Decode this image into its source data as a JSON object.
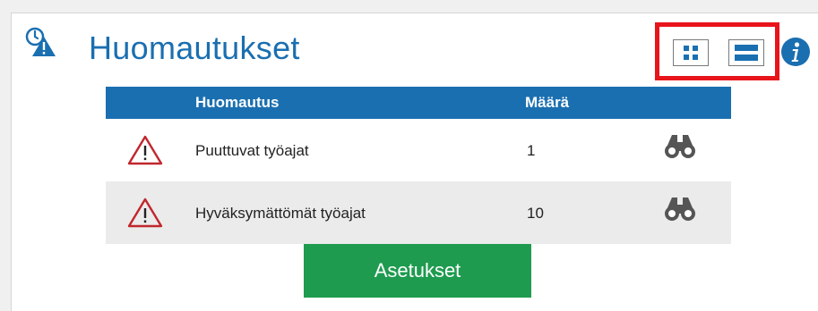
{
  "widget": {
    "title": "Huomautukset",
    "header_icon": "clock-warning-icon",
    "info_icon": "info-icon",
    "view_toggle": {
      "grid_icon": "grid-view-icon",
      "list_icon": "list-view-icon"
    }
  },
  "table": {
    "headers": [
      "Huomautus",
      "Määrä"
    ],
    "rows": [
      {
        "icon": "warning-icon",
        "name": "Puuttuvat työajat",
        "count": "1",
        "action_icon": "binoculars-icon"
      },
      {
        "icon": "warning-icon",
        "name": "Hyväksymättömät työajat",
        "count": "10",
        "action_icon": "binoculars-icon"
      }
    ]
  },
  "settings_button": {
    "label": "Asetukset"
  },
  "colors": {
    "accent": "#1a6fb0",
    "highlight_border": "#e8141b",
    "button_green": "#1e9b4f",
    "warning_red": "#c0272d"
  }
}
